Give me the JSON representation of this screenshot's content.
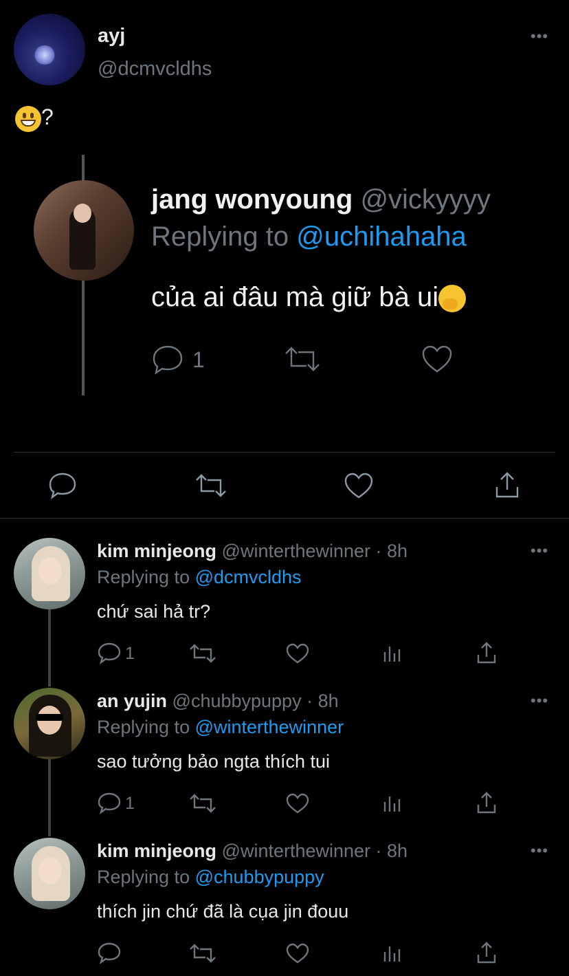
{
  "main_tweet": {
    "name": "ayj",
    "handle": "@dcmvcldhs",
    "more_label": "•••",
    "text": "?",
    "emoji": "grinning-face"
  },
  "quoted": {
    "name": "jang wonyoung",
    "handle": "@vickyyyy",
    "replying_prefix": "Replying to",
    "replying_to": "@uchihahaha",
    "text": "của ai đâu mà giữ bà ui",
    "emoji": "face-with-hand-over-mouth",
    "reply_count": "1"
  },
  "main_actions": [
    "reply-icon",
    "retweet-icon",
    "like-icon",
    "share-icon"
  ],
  "replies": [
    {
      "name": "kim minjeong",
      "meta": "@winterthewinner · 8h",
      "replying_prefix": "Replying to",
      "replying_to": "@dcmvcldhs",
      "text": "chứ sai hả tr?",
      "reply_count": "1"
    },
    {
      "name": "an yujin",
      "meta": "@chubbypuppy · 8h",
      "replying_prefix": "Replying to",
      "replying_to": "@winterthewinner",
      "text": "sao tưởng bảo ngta thích tui",
      "reply_count": "1"
    },
    {
      "name": "kim minjeong",
      "meta": "@winterthewinner · 8h",
      "replying_prefix": "Replying to",
      "replying_to": "@chubbypuppy",
      "text": "thích jin chứ đã là cụa jin đouu",
      "reply_count": ""
    }
  ],
  "colors": {
    "background": "#000000",
    "link": "#1d9bf0",
    "muted": "#6e767d"
  }
}
